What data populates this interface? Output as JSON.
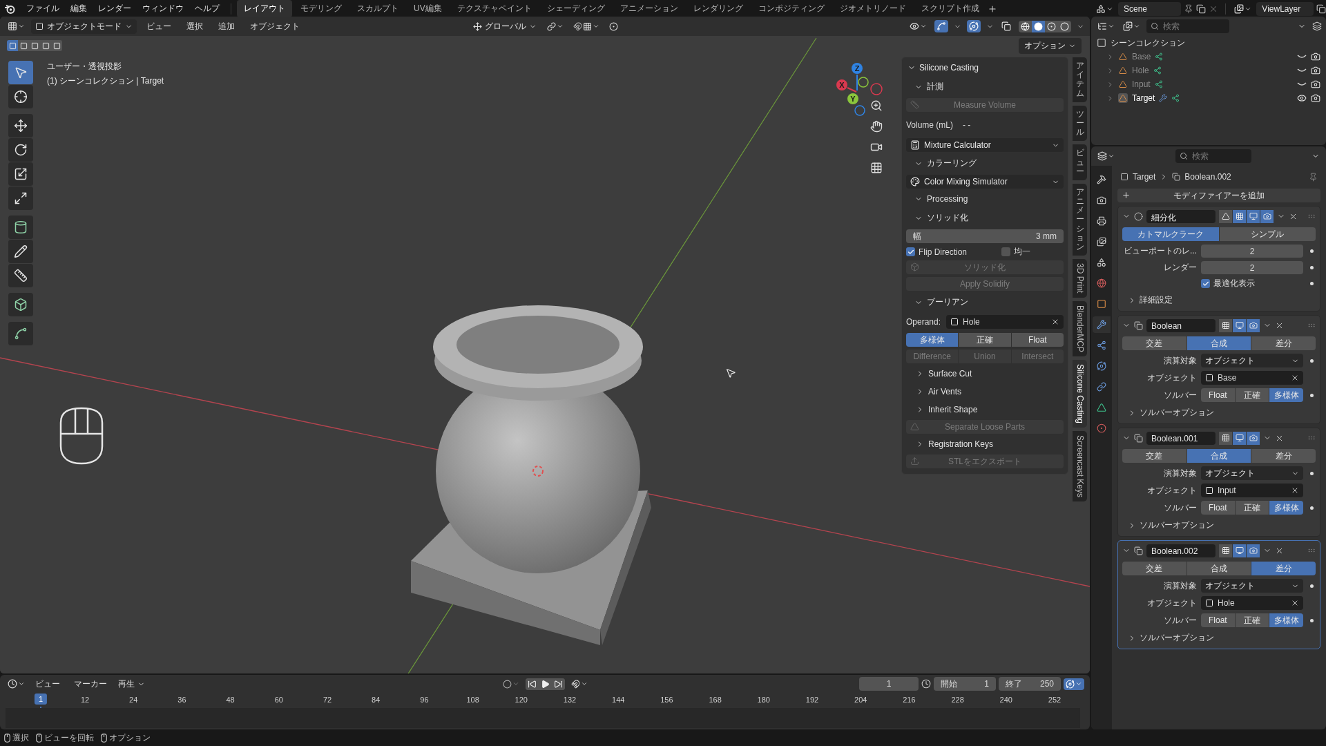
{
  "top_bar": {
    "menus": [
      "ファイル",
      "編集",
      "レンダー",
      "ウィンドウ",
      "ヘルプ"
    ],
    "workspaces": [
      {
        "label": "レイアウト",
        "selected": true
      },
      {
        "label": "モデリング",
        "selected": false
      },
      {
        "label": "スカルプト",
        "selected": false
      },
      {
        "label": "UV編集",
        "selected": false
      },
      {
        "label": "テクスチャペイント",
        "selected": false
      },
      {
        "label": "シェーディング",
        "selected": false
      },
      {
        "label": "アニメーション",
        "selected": false
      },
      {
        "label": "レンダリング",
        "selected": false
      },
      {
        "label": "コンポジティング",
        "selected": false
      },
      {
        "label": "ジオメトリノード",
        "selected": false
      },
      {
        "label": "スクリプト作成",
        "selected": false
      }
    ],
    "scene": "Scene",
    "view_layer": "ViewLayer"
  },
  "viewport": {
    "header": {
      "mode": "オブジェクトモード",
      "menus": [
        "ビュー",
        "選択",
        "追加",
        "オブジェクト"
      ],
      "orientation": "グローバル",
      "shading": [
        {
          "selected": false
        },
        {
          "selected": true
        },
        {
          "selected": false
        },
        {
          "selected": false
        }
      ],
      "options": "オプション"
    },
    "select_modes": [
      {
        "selected": true
      },
      {
        "selected": false
      },
      {
        "selected": false
      },
      {
        "selected": false
      },
      {
        "selected": false
      }
    ],
    "view_name": "ユーザー・透視投影",
    "context": "(1) シーンコレクション | Target",
    "gizmo": [
      {
        "label": "X",
        "color": "#d9394f"
      },
      {
        "label": "Y",
        "color": "#8ac53c"
      },
      {
        "label": "Z",
        "color": "#2f83e3"
      }
    ],
    "tool_groups": [
      [
        {
          "kind": "select",
          "selected": true
        },
        {
          "kind": "cursor",
          "selected": false
        }
      ],
      [
        {
          "kind": "move",
          "selected": false
        },
        {
          "kind": "rotate",
          "selected": false
        },
        {
          "kind": "scale",
          "selected": false
        },
        {
          "kind": "transform",
          "selected": false
        }
      ],
      [
        {
          "kind": "add_cylinder",
          "selected": false
        },
        {
          "kind": "annotate",
          "selected": false
        },
        {
          "kind": "measure",
          "selected": false
        }
      ],
      [
        {
          "kind": "add_cube",
          "selected": false
        }
      ],
      [
        {
          "kind": "curve",
          "selected": false
        }
      ]
    ]
  },
  "sidebar": {
    "title": "Silicone Casting",
    "rows": [
      {
        "kind": "subpanel",
        "label": "計測",
        "expanded": true
      },
      {
        "kind": "measure",
        "text": "Measure Volume",
        "disabled": true
      },
      {
        "kind": "readout",
        "label": "Volume (mL)",
        "value": "- -"
      },
      {
        "kind": "calculator",
        "text": "Mixture Calculator"
      },
      {
        "kind": "subpanel",
        "label": "カラーリング",
        "expanded": true
      },
      {
        "kind": "palette",
        "text": "Color Mixing Simulator"
      },
      {
        "kind": "subpanel",
        "label": "Processing",
        "expanded": true
      },
      {
        "kind": "subpanel",
        "label": "ソリッド化",
        "expanded": true
      },
      {
        "kind": "number",
        "label": "幅",
        "value": "3 mm"
      },
      {
        "kind": "checks",
        "items": [
          {
            "label": "Flip Direction",
            "checked": true
          },
          {
            "label": "均一",
            "checked": false
          }
        ]
      },
      {
        "kind": "solidify",
        "text": "ソリッド化",
        "disabled": true
      },
      {
        "kind": "apply",
        "text": "Apply Solidify",
        "disabled": true
      },
      {
        "kind": "subpanel",
        "label": "ブーリアン",
        "expanded": true
      },
      {
        "kind": "operand",
        "label": "Operand:",
        "value": "Hole"
      },
      {
        "kind": "segmented",
        "disabled": false,
        "items": [
          {
            "label": "多様体",
            "selected": true
          },
          {
            "label": "正確",
            "selected": false
          },
          {
            "label": "Float",
            "selected": false
          }
        ]
      },
      {
        "kind": "segmented",
        "disabled": true,
        "items": [
          {
            "label": "Difference",
            "selected": false
          },
          {
            "label": "Union",
            "selected": false
          },
          {
            "label": "Intersect",
            "selected": false
          }
        ]
      },
      {
        "kind": "subpanel",
        "label": "Surface Cut",
        "expanded": false
      },
      {
        "kind": "subpanel",
        "label": "Air Vents",
        "expanded": false
      },
      {
        "kind": "subpanel",
        "label": "Inherit Shape",
        "expanded": false
      },
      {
        "kind": "separate",
        "text": "Separate Loose Parts",
        "disabled": true
      },
      {
        "kind": "subpanel",
        "label": "Registration Keys",
        "expanded": false
      },
      {
        "kind": "export",
        "text": "STLをエクスポート",
        "disabled": true
      }
    ]
  },
  "sidebar_tabs": [
    {
      "label": "アイテム",
      "kind": "stacked",
      "selected": false
    },
    {
      "label": "ツール",
      "kind": "stacked",
      "selected": false
    },
    {
      "label": "ビュー",
      "kind": "stacked",
      "selected": false
    },
    {
      "label": "アニメーション",
      "kind": "stacked",
      "selected": false
    },
    {
      "label": "3D Print",
      "kind": "rotated",
      "selected": false
    },
    {
      "label": "BlenderMCP",
      "kind": "rotated",
      "selected": false
    },
    {
      "label": "Silicone Casting",
      "kind": "rotated",
      "selected": true
    },
    {
      "label": "Screencast Keys",
      "kind": "rotated",
      "selected": false
    }
  ],
  "timeline": {
    "menus": [
      "ビュー",
      "マーカー"
    ],
    "playback": "再生",
    "current_frame": "1",
    "start_label": "開始",
    "start": "1",
    "end_label": "終了",
    "end": "250",
    "playhead": "1",
    "ticks": [
      "12",
      "24",
      "36",
      "48",
      "60",
      "72",
      "84",
      "96",
      "108",
      "120",
      "132",
      "144",
      "156",
      "168",
      "180",
      "192",
      "204",
      "216",
      "228",
      "240",
      "252"
    ]
  },
  "status_bar": [
    "選択",
    "ビューを回転",
    "オプション"
  ],
  "outliner": {
    "search_placeholder": "検索",
    "root": "シーンコレクション",
    "objects": [
      {
        "name": "Base",
        "visible": false,
        "has_modifiers": false
      },
      {
        "name": "Hole",
        "visible": false,
        "has_modifiers": false
      },
      {
        "name": "Input",
        "visible": false,
        "has_modifiers": false
      },
      {
        "name": "Target",
        "visible": true,
        "has_modifiers": true
      }
    ]
  },
  "properties": {
    "search_placeholder": "検索",
    "breadcrumb": [
      "Target",
      "Boolean.002"
    ],
    "add_modifier": "モディファイアーを追加",
    "tabs": [
      {
        "kind": "tool",
        "selected": false
      },
      {
        "kind": "render",
        "selected": false
      },
      {
        "kind": "output",
        "selected": false
      },
      {
        "kind": "view_layer",
        "selected": false
      },
      {
        "kind": "scene",
        "selected": false
      },
      {
        "kind": "world",
        "selected": false
      },
      {
        "kind": "object",
        "selected": false
      },
      {
        "kind": "modifier",
        "selected": true
      },
      {
        "kind": "particles",
        "selected": false
      },
      {
        "kind": "physics",
        "selected": false
      },
      {
        "kind": "constraints",
        "selected": false
      },
      {
        "kind": "data",
        "selected": false
      },
      {
        "kind": "material",
        "selected": false
      }
    ],
    "modifiers": [
      {
        "kind": "subdivision",
        "name": "細分化",
        "active": false,
        "toggles": [
          {
            "kind": "cage",
            "on": false
          },
          {
            "kind": "edit",
            "on": true
          },
          {
            "kind": "viewport",
            "on": true
          },
          {
            "kind": "render",
            "on": true
          }
        ],
        "methods": [
          {
            "label": "カトマルクラーク",
            "selected": true
          },
          {
            "label": "シンプル",
            "selected": false
          }
        ],
        "fields": [
          {
            "label": "ビューポートのレ...",
            "value": "2"
          },
          {
            "label": "レンダー",
            "value": "2"
          }
        ],
        "option": {
          "label": "最適化表示",
          "checked": true
        },
        "subpanel": "詳細設定"
      },
      {
        "kind": "boolean",
        "name": "Boolean",
        "active": false,
        "toggles": [
          {
            "kind": "edit",
            "on": false
          },
          {
            "kind": "viewport",
            "on": true
          },
          {
            "kind": "render",
            "on": true
          }
        ],
        "operations": [
          {
            "label": "交差",
            "selected": false
          },
          {
            "label": "合成",
            "selected": true
          },
          {
            "label": "差分",
            "selected": false
          }
        ],
        "operand_type_label": "演算対象",
        "operand_type": "オブジェクト",
        "object_label": "オブジェクト",
        "object": "Base",
        "solver_label": "ソルバー",
        "solvers": [
          {
            "label": "Float",
            "selected": false
          },
          {
            "label": "正確",
            "selected": false
          },
          {
            "label": "多様体",
            "selected": true
          }
        ],
        "subpanel": "ソルバーオプション"
      },
      {
        "kind": "boolean",
        "name": "Boolean.001",
        "active": false,
        "toggles": [
          {
            "kind": "edit",
            "on": false
          },
          {
            "kind": "viewport",
            "on": true
          },
          {
            "kind": "render",
            "on": true
          }
        ],
        "operations": [
          {
            "label": "交差",
            "selected": false
          },
          {
            "label": "合成",
            "selected": true
          },
          {
            "label": "差分",
            "selected": false
          }
        ],
        "operand_type_label": "演算対象",
        "operand_type": "オブジェクト",
        "object_label": "オブジェクト",
        "object": "Input",
        "solver_label": "ソルバー",
        "solvers": [
          {
            "label": "Float",
            "selected": false
          },
          {
            "label": "正確",
            "selected": false
          },
          {
            "label": "多様体",
            "selected": true
          }
        ],
        "subpanel": "ソルバーオプション"
      },
      {
        "kind": "boolean",
        "name": "Boolean.002",
        "active": true,
        "toggles": [
          {
            "kind": "edit",
            "on": false
          },
          {
            "kind": "viewport",
            "on": true
          },
          {
            "kind": "render",
            "on": true
          }
        ],
        "operations": [
          {
            "label": "交差",
            "selected": false
          },
          {
            "label": "合成",
            "selected": false
          },
          {
            "label": "差分",
            "selected": true
          }
        ],
        "operand_type_label": "演算対象",
        "operand_type": "オブジェクト",
        "object_label": "オブジェクト",
        "object": "Hole",
        "solver_label": "ソルバー",
        "solvers": [
          {
            "label": "Float",
            "selected": false
          },
          {
            "label": "正確",
            "selected": false
          },
          {
            "label": "多様体",
            "selected": true
          }
        ],
        "subpanel": "ソルバーオプション"
      }
    ]
  }
}
